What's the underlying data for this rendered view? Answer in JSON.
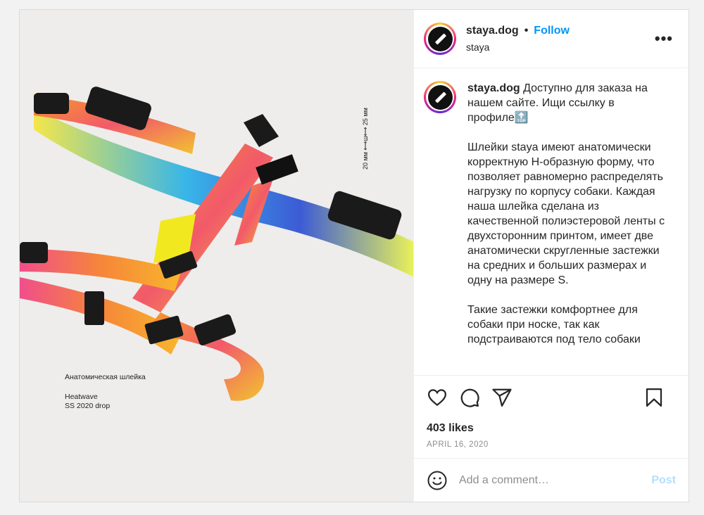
{
  "post": {
    "image_caption_title": "Анатомическая шлейка",
    "image_caption_line1": "Heatwave",
    "image_caption_line2": "SS 2020 drop",
    "image_dimension": "20 мм ⟷ш⟷ 25 мм"
  },
  "header": {
    "username": "staya.dog",
    "separator": "•",
    "follow_label": "Follow",
    "subtitle": "staya",
    "more_label": "•••"
  },
  "caption": {
    "username": "staya.dog",
    "text": " Доступно для заказа на нашем сайте. Ищи ссылку в профиле🔝\n\nШлейки staya имеют анатомически корректную H-образную форму, что позволяет равномерно распределять нагрузку по корпусу собаки. Каждая наша шлейка сделана из качественной полиэстеровой ленты с двухсторонним принтом, имеет две анатомически скругленные застежки на средних и больших размерах и одну на размере S.\n\nТакие застежки комфортнее для собаки при носке, так как подстраиваются под тело собаки"
  },
  "actions": {
    "like_icon": "heart-icon",
    "comment_icon": "comment-icon",
    "share_icon": "paper-plane-icon",
    "save_icon": "bookmark-icon"
  },
  "likes": "403 likes",
  "date": "APRIL 16, 2020",
  "comment_box": {
    "emoji_icon": "smiley-icon",
    "placeholder": "Add a comment…",
    "post_label": "Post"
  },
  "colors": {
    "accent": "#0095f6",
    "post_disabled": "#b2dffc",
    "muted": "#8e8e8e"
  }
}
